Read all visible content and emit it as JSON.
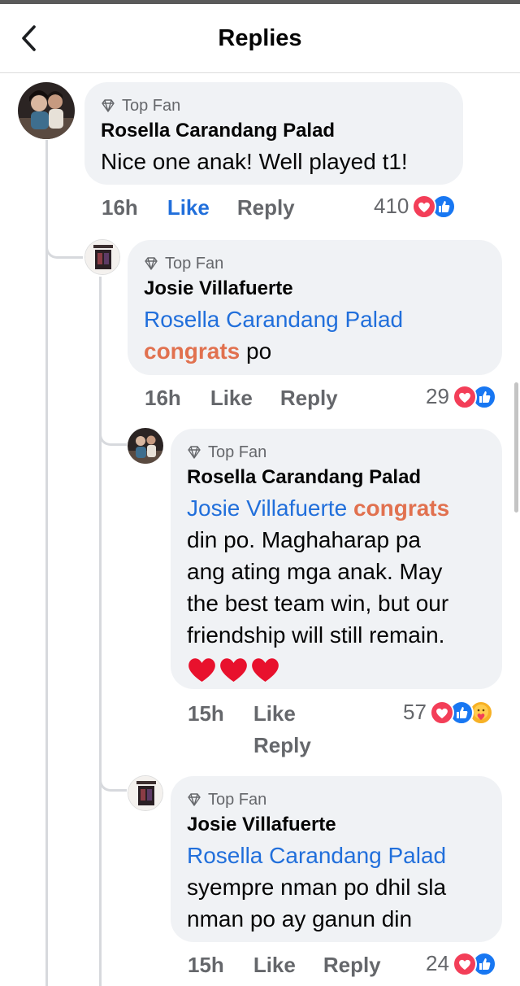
{
  "header": {
    "title": "Replies"
  },
  "badge_label": "Top Fan",
  "comments": [
    {
      "author": "Rosella Carandang Palad",
      "text": "Nice one anak! Well played t1!",
      "time": "16h",
      "like": "Like",
      "reply": "Reply",
      "reaction_count": "410",
      "reactions": [
        "love",
        "like"
      ],
      "like_active": true
    },
    {
      "author": "Josie Villafuerte",
      "mention": "Rosella Carandang Palad",
      "highlight": "congrats",
      "text_after": " po",
      "time": "16h",
      "like": "Like",
      "reply": "Reply",
      "reaction_count": "29",
      "reactions": [
        "love",
        "like"
      ]
    },
    {
      "author": "Rosella Carandang Palad",
      "mention": "Josie Villafuerte",
      "highlight": "congrats",
      "text_lines": [
        "din po. Maghaharap pa",
        "ang ating mga anak. May",
        "the best team win, but our",
        "friendship will still remain."
      ],
      "emoji": [
        "red-heart",
        "red-heart",
        "red-heart"
      ],
      "time": "15h",
      "like": "Like",
      "reply": "Reply",
      "reaction_count": "57",
      "reactions": [
        "love",
        "like",
        "care"
      ]
    },
    {
      "author": "Josie Villafuerte",
      "mention": "Rosella Carandang Palad",
      "text_lines": [
        "syempre nman po dhil sla",
        "nman po ay ganun din"
      ],
      "time": "15h",
      "like": "Like",
      "reply": "Reply",
      "reaction_count": "24",
      "reactions": [
        "love",
        "like"
      ]
    }
  ],
  "colors": {
    "bubble": "#f0f2f5",
    "mention": "#216fdb",
    "highlight": "#e1714f",
    "secondary_text": "#65676b",
    "love": "#f33e58",
    "like": "#1877f2"
  }
}
